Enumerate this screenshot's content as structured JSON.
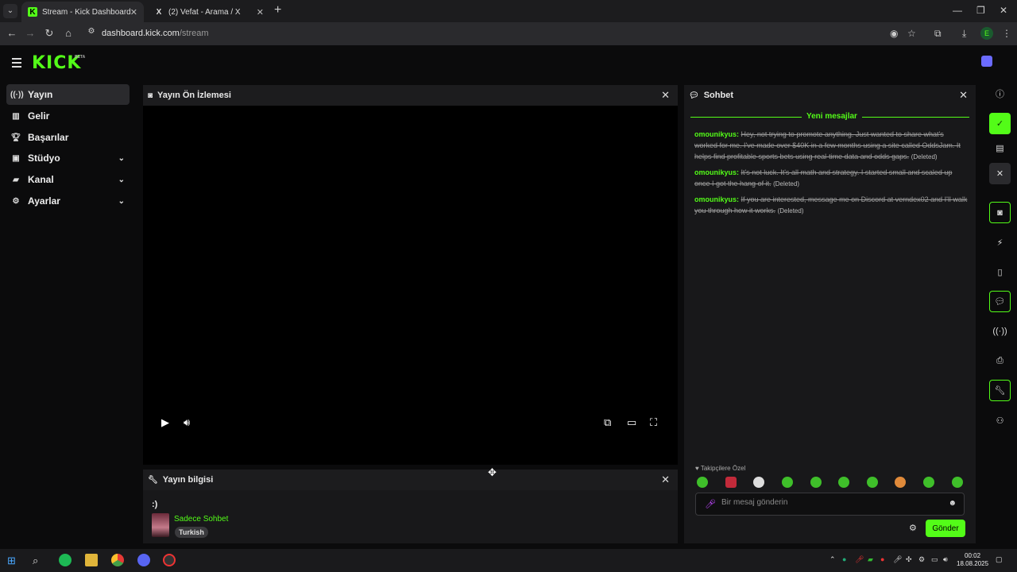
{
  "browser": {
    "tabs": [
      {
        "title": "Stream - Kick Dashboard",
        "favicon": "kick-icon"
      },
      {
        "title": "(2) Vefat - Arama / X",
        "favicon": "x-icon"
      }
    ],
    "url_host": "dashboard.kick.com",
    "url_path": "/stream",
    "profile_initial": "E"
  },
  "header": {
    "logo": "KICK",
    "beta": "BETA"
  },
  "sidebar": {
    "items": [
      {
        "label": "Yayın",
        "icon": "broadcast-icon"
      },
      {
        "label": "Gelir",
        "icon": "revenue-icon"
      },
      {
        "label": "Başarılar",
        "icon": "trophy-icon"
      },
      {
        "label": "Stüdyo",
        "icon": "studio-icon"
      },
      {
        "label": "Kanal",
        "icon": "channel-icon"
      },
      {
        "label": "Ayarlar",
        "icon": "gear-icon"
      }
    ]
  },
  "preview": {
    "title": "Yayın Ön İzlemesi"
  },
  "stream_info": {
    "title": "Yayın bilgisi",
    "stream_title": ":)",
    "category": "Sadece Sohbet",
    "language": "Turkish"
  },
  "chat": {
    "title": "Sohbet",
    "new_messages": "Yeni mesajlar",
    "messages": [
      {
        "user": "omounikyus",
        "text": "Hey, not trying to promote anything. Just wanted to share what's worked for me. I've made over $40K in a few months using a site called OddsJam. It helps find profitable sports bets using real-time data and odds gaps.",
        "status": "(Deleted)"
      },
      {
        "user": "omounikyus",
        "text": "It's not luck. It's all math and strategy. I started small and scaled up once I got the hang of it.",
        "status": "(Deleted)"
      },
      {
        "user": "omounikyus",
        "text": "If you are interested, message me on Discord at verndex02 and I'll walk you through how it works.",
        "status": "(Deleted)"
      }
    ],
    "followers_only": "Takipçilere Özel",
    "placeholder": "Bir mesaj gönderin",
    "send_label": "Gönder"
  },
  "taskbar": {
    "time": "00:02",
    "date": "18.08.2025"
  },
  "colors": {
    "accent": "#53fc18",
    "panel": "#18181a",
    "background": "#0b0b0c"
  }
}
